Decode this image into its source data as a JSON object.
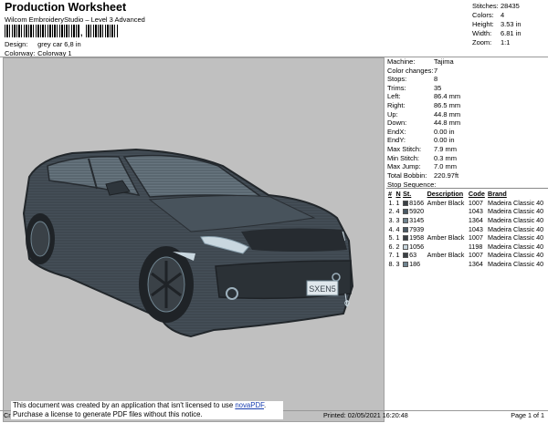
{
  "header": {
    "title": "Production Worksheet",
    "subtitle": "Wilcom EmbroideryStudio – Level 3 Advanced",
    "barcode_separator": ",",
    "design_label": "Design:",
    "design_value": "grey car 6,8 in",
    "colorway_label": "Colorway:",
    "colorway_value": "Colorway 1"
  },
  "stats": [
    {
      "label": "Stitches:",
      "value": "28435"
    },
    {
      "label": "Colors:",
      "value": "4"
    },
    {
      "label": "Height:",
      "value": "3.53 in"
    },
    {
      "label": "Width:",
      "value": "6.81 in"
    },
    {
      "label": "Zoom:",
      "value": "1:1"
    }
  ],
  "machine": [
    {
      "label": "Machine:",
      "value": "Tajima"
    },
    {
      "label": "Color changes:",
      "value": "7"
    },
    {
      "label": "Stops:",
      "value": "8"
    },
    {
      "label": "Trims:",
      "value": "35"
    },
    {
      "label": "Left:",
      "value": "86.4 mm"
    },
    {
      "label": "Right:",
      "value": "86.5 mm"
    },
    {
      "label": "Up:",
      "value": "44.8 mm"
    },
    {
      "label": "Down:",
      "value": "44.8 mm"
    },
    {
      "label": "EndX:",
      "value": "0.00 in"
    },
    {
      "label": "EndY:",
      "value": "0.00 in"
    },
    {
      "label": "Max Stitch:",
      "value": "7.9 mm"
    },
    {
      "label": "Min Stitch:",
      "value": "0.3 mm"
    },
    {
      "label": "Max Jump:",
      "value": "7.0 mm"
    },
    {
      "label": "Total Bobbin:",
      "value": "220.97ft"
    }
  ],
  "stop_sequence": {
    "heading": "Stop Sequence:",
    "columns": [
      "#",
      "N",
      "St.",
      "Description",
      "Code",
      "Brand"
    ],
    "rows": [
      {
        "num": "1.",
        "n": "1",
        "color": "#3a3f44",
        "st": "8166",
        "desc": "Amber Black",
        "code": "1007",
        "brand": "Madeira Classic 40"
      },
      {
        "num": "2.",
        "n": "4",
        "color": "#4a5a66",
        "st": "5920",
        "desc": "",
        "code": "1043",
        "brand": "Madeira Classic 40"
      },
      {
        "num": "3.",
        "n": "3",
        "color": "#6f8490",
        "st": "3145",
        "desc": "",
        "code": "1364",
        "brand": "Madeira Classic 40"
      },
      {
        "num": "4.",
        "n": "4",
        "color": "#4a5a66",
        "st": "7939",
        "desc": "",
        "code": "1043",
        "brand": "Madeira Classic 40"
      },
      {
        "num": "5.",
        "n": "1",
        "color": "#3a3f44",
        "st": "1958",
        "desc": "Amber Black",
        "code": "1007",
        "brand": "Madeira Classic 40"
      },
      {
        "num": "6.",
        "n": "2",
        "color": "#c9d7df",
        "st": "1056",
        "desc": "",
        "code": "1198",
        "brand": "Madeira Classic 40"
      },
      {
        "num": "7.",
        "n": "1",
        "color": "#3a3f44",
        "st": "63",
        "desc": "Amber Black",
        "code": "1007",
        "brand": "Madeira Classic 40"
      },
      {
        "num": "8.",
        "n": "3",
        "color": "#6f8490",
        "st": "186",
        "desc": "",
        "code": "1364",
        "brand": "Madeira Classic 40"
      }
    ]
  },
  "design_preview": {
    "plate_text": "SXEN5",
    "colors": {
      "body": "#3f4850",
      "dark": "#262b30",
      "light": "#6f8490",
      "glass": "#58646d",
      "highlight": "#c9d7df",
      "background": "#c0c0c0"
    }
  },
  "notice": {
    "line1_pre": "This document was created by an application that isn't licensed to use ",
    "link": "novaPDF",
    "line1_post": ".",
    "line2": "Purchase a license to generate PDF files without this notice."
  },
  "footer": {
    "left": "Cr",
    "printed": "Printed: 02/05/2021 16:20:48",
    "page": "Page 1 of 1"
  }
}
